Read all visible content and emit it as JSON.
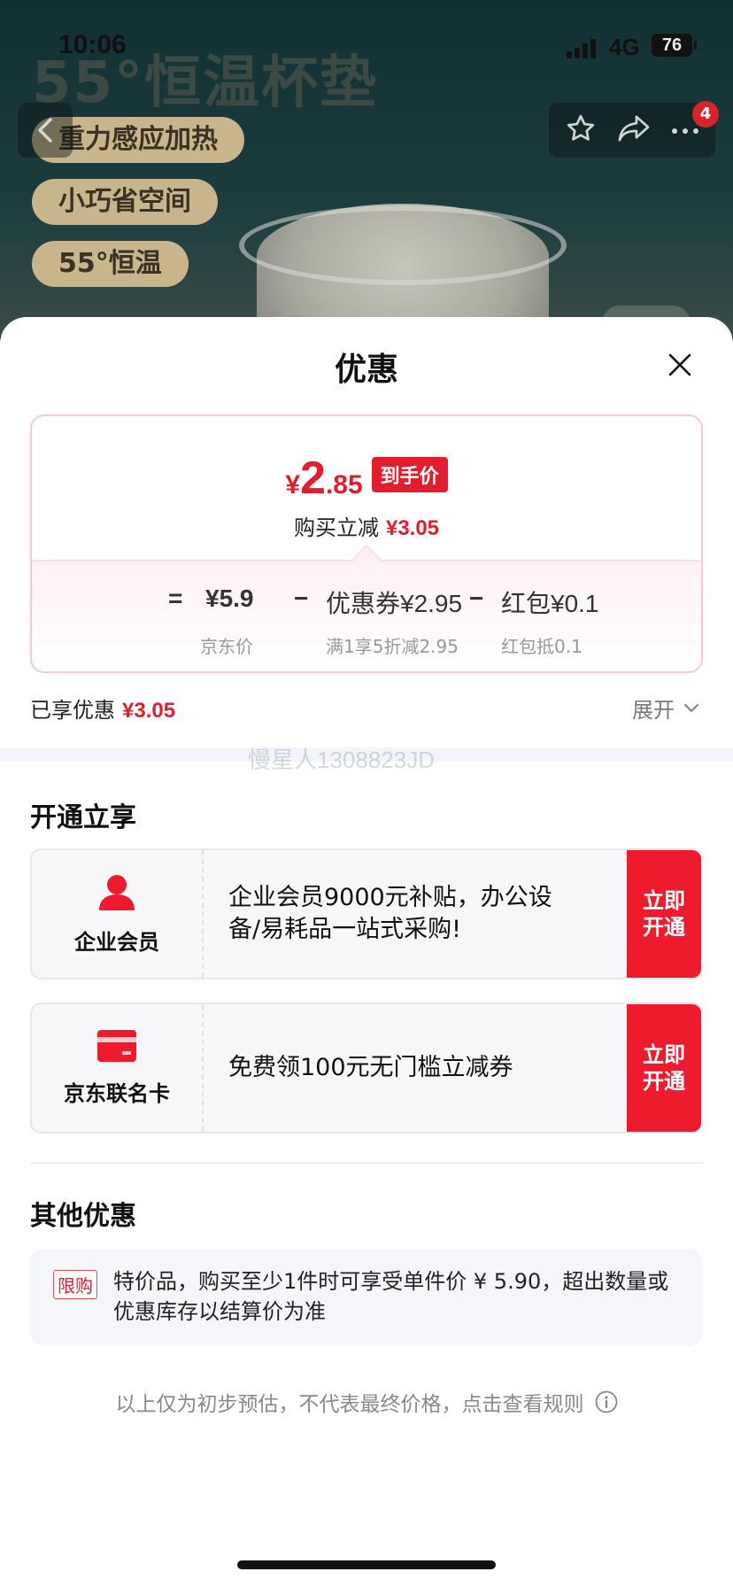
{
  "status_bar": {
    "time": "10:06",
    "network": "4G",
    "battery": "76"
  },
  "background": {
    "headline": "55°恒温杯垫",
    "pills": [
      "重力感应加热",
      "小巧省空间",
      "55°恒温"
    ],
    "cart_badge": "4"
  },
  "sheet": {
    "title": "优惠",
    "price_card": {
      "final_currency": "¥",
      "final_int": "2",
      "final_dec": ".85",
      "final_tag": "到手价",
      "reduce_label": "购买立减",
      "reduce_value": "¥3.05",
      "equation": {
        "eq_sign": "=",
        "base_price": "¥5.9",
        "base_label": "京东价",
        "minus1": "−",
        "coupon": "优惠券¥2.95",
        "coupon_label": "满1享5折减2.95",
        "minus2": "−",
        "redpacket": "红包¥0.1",
        "redpacket_label": "红包抵0.1"
      }
    },
    "enjoyed_label": "已享优惠",
    "enjoyed_value": "¥3.05",
    "expand_label": "展开",
    "watermark": "慢星人1308823JD",
    "open_section_title": "开通立享",
    "promos": [
      {
        "name": "企业会员",
        "desc": "企业会员9000元补贴，办公设备/易耗品一站式采购!",
        "button": "立即开通"
      },
      {
        "name": "京东联名卡",
        "desc": "免费领100元无门槛立减券",
        "button": "立即开通"
      }
    ],
    "other_section_title": "其他优惠",
    "other": {
      "tag": "限购",
      "text": "特价品，购买至少1件时可享受单件价 ¥ 5.90，超出数量或优惠库存以结算价为准"
    },
    "footer_note": "以上仅为初步预估，不代表最终价格，点击查看规则"
  },
  "colors": {
    "accent_red": "#e21d2d",
    "button_red": "#ee1b2e",
    "card_border": "#f5c9d2"
  }
}
